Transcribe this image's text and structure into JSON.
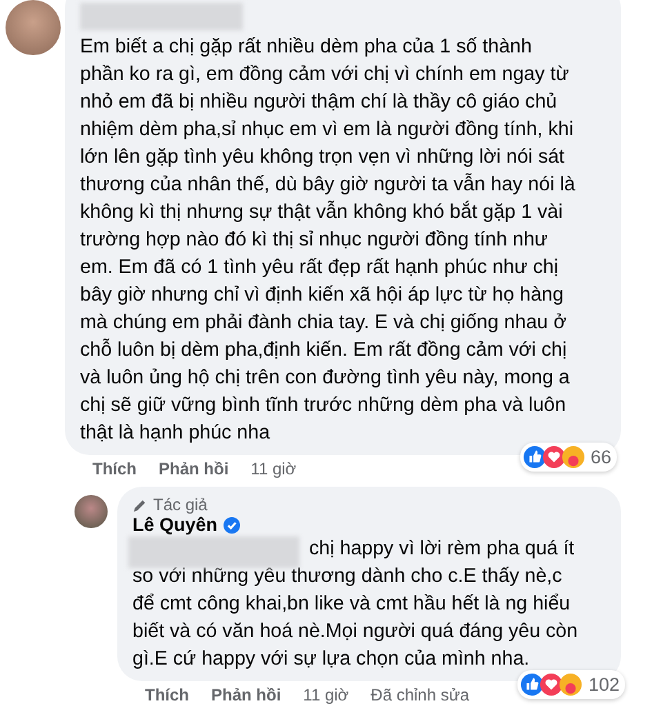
{
  "comments": [
    {
      "author_redacted": true,
      "text": "Em biết a chị gặp rất nhiều dèm pha của 1 số thành\nphần ko ra gì, em đồng cảm với chị vì chính em ngay từ\nnhỏ em đã bị nhiều người thậm chí là thầy cô giáo chủ\nnhiệm dèm pha,sỉ nhục em vì em là người đồng tính, khi\nlớn lên gặp tình yêu không trọn vẹn vì những lời nói sát\nthương của nhân thế, dù bây giờ người ta vẫn hay nói là\nkhông kì thị nhưng sự thật vẫn không khó bắt gặp 1 vài\ntrường hợp nào đó kì thị sỉ nhục người đồng tính như\nem. Em đã có 1 tình yêu rất đẹp rất hạnh phúc như chị\nbây giờ nhưng chỉ vì định kiến xã hội áp lực từ họ hàng\nmà chúng em phải đành chia tay. E và chị giống nhau ở\nchỗ luôn bị dèm pha,định kiến. Em rất đồng cảm với chị\nvà luôn ủng hộ chị trên con đường tình yêu này, mong a\nchị sẽ giữ vững bình tĩnh trước những dèm pha và luôn\nthật là hạnh phúc nha",
      "actions": [
        "Thích",
        "Phản hồi",
        "11 giờ"
      ],
      "reaction_count": "66"
    },
    {
      "badge": "Tác giả",
      "author": "Lê Quyên",
      "verified": true,
      "text_redacted": true,
      "text": "chị happy vì lời rèm pha quá ít\nso với những yêu thương dành cho c.E thấy nè,c\nđể cmt công khai,bn like và cmt hầu hết là ng hiểu\nbiết và có văn hoá nè.Mọi người quá đáng yêu còn\ngì.E cứ happy với sự lựa chọn của mình nha.",
      "actions": [
        "Thích",
        "Phản hồi",
        "11 giờ",
        "Đã chỉnh sửa"
      ],
      "reaction_count": "102"
    }
  ]
}
